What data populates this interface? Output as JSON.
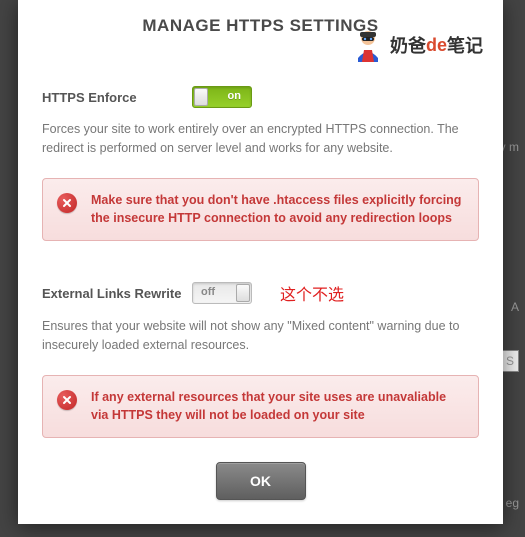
{
  "modal": {
    "title": "MANAGE HTTPS SETTINGS",
    "watermark": {
      "prefix": "奶爸",
      "de": "de",
      "suffix": "笔记"
    }
  },
  "settings": {
    "enforce": {
      "label": "HTTPS Enforce",
      "toggle_state": "on",
      "toggle_text": "on",
      "description": "Forces your site to work entirely over an encrypted HTTPS connection. The redirect is performed on server level and works for any website.",
      "warning": "Make sure that you don't have .htaccess files explicitly forcing the insecure HTTP connection to avoid any redirection loops"
    },
    "rewrite": {
      "label": "External Links Rewrite",
      "toggle_state": "off",
      "toggle_text": "off",
      "annotation": "这个不选",
      "description": "Ensures that your website will not show any \"Mixed content\" warning due to insecurely loaded external resources.",
      "warning": "If any external resources that your site uses are unavaliable via HTTPS they will not be loaded on your site"
    }
  },
  "buttons": {
    "ok": "OK"
  },
  "bg": {
    "right1": "y m",
    "right2": "A",
    "right3": "S",
    "right4": "eg"
  }
}
